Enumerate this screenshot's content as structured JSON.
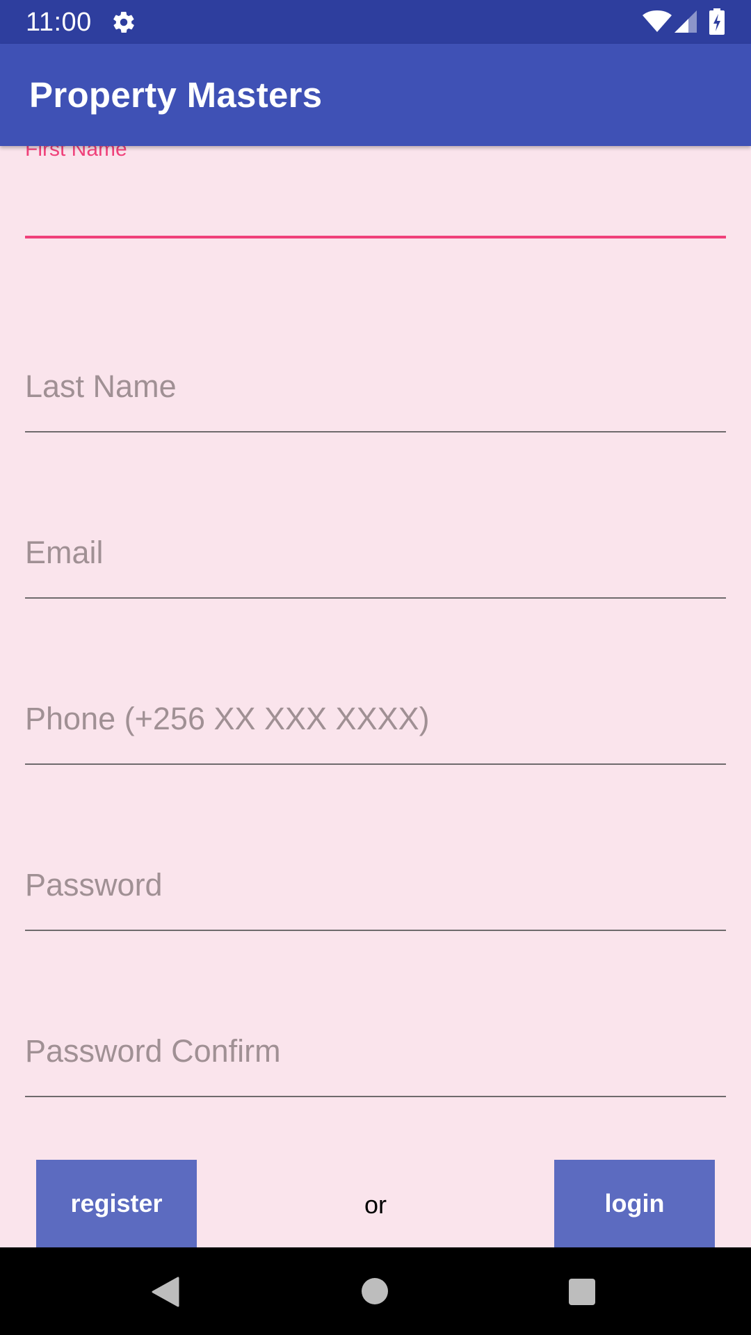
{
  "status_bar": {
    "time": "11:00",
    "icons": [
      "gear-icon",
      "wifi-icon",
      "cell-signal-icon",
      "battery-charging-icon"
    ]
  },
  "app_bar": {
    "title": "Property Masters"
  },
  "form": {
    "fields": [
      {
        "name": "first-name",
        "label": "First Name",
        "value": "",
        "focused": true
      },
      {
        "name": "last-name",
        "placeholder": "Last Name",
        "value": ""
      },
      {
        "name": "email",
        "placeholder": "Email",
        "value": ""
      },
      {
        "name": "phone",
        "placeholder": "Phone (+256 XX XXX XXXX)",
        "value": ""
      },
      {
        "name": "password",
        "placeholder": "Password",
        "value": ""
      },
      {
        "name": "password-confirm",
        "placeholder": "Password Confirm",
        "value": ""
      }
    ]
  },
  "actions": {
    "register_label": "register",
    "or_label": "or",
    "login_label": "login"
  },
  "nav_bar": {
    "icons": [
      "back-icon",
      "home-icon",
      "recents-icon"
    ]
  },
  "colors": {
    "status_bar": "#2E3E9E",
    "app_bar": "#3F51B5",
    "background": "#FAE4EC",
    "accent": "#F0407A",
    "button": "#5C6BC0"
  }
}
